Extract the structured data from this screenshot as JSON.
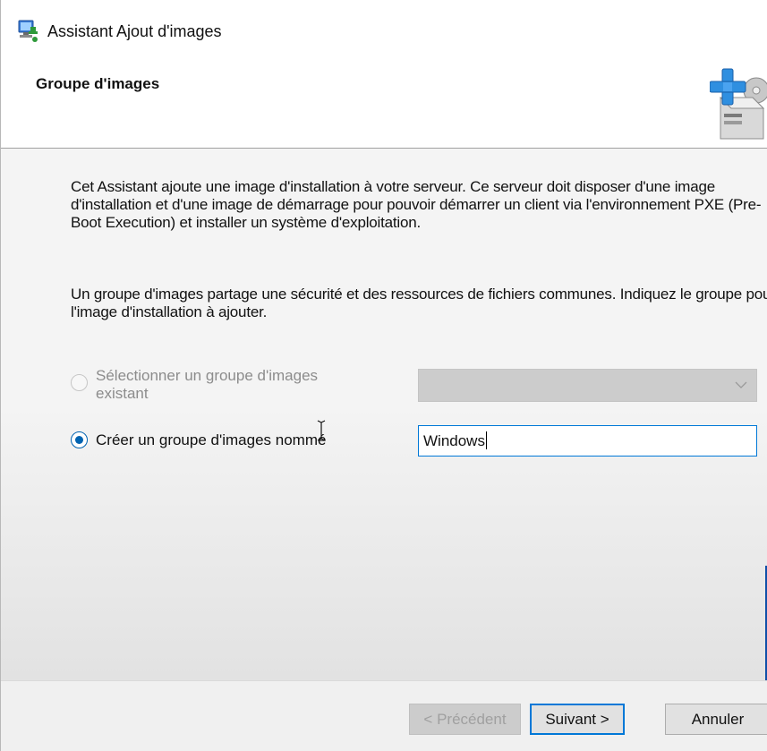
{
  "window": {
    "title": "Assistant Ajout d'images",
    "icon": "wds-server-icon"
  },
  "header": {
    "title": "Groupe d'images",
    "icon": "add-image-disk-icon"
  },
  "content": {
    "paragraph1": "Cet Assistant ajoute une image d'installation à votre serveur. Ce serveur doit disposer d'une image d'installation et d'une image de démarrage pour pouvoir démarrer un client via l'environnement PXE (Pre-Boot Execution) et installer un système d'exploitation.",
    "paragraph2": "Un groupe d'images partage une sécurité et des ressources de fichiers communes. Indiquez le groupe pour l'image d'installation à ajouter.",
    "option_existing": {
      "label": "Sélectionner un groupe d'images existant",
      "selected": false,
      "enabled": false,
      "combo_value": ""
    },
    "option_new": {
      "label": "Créer un groupe d'images nommé",
      "selected": true,
      "enabled": true,
      "input_value": "Windows"
    }
  },
  "footer": {
    "prev_label": "< Précédent",
    "next_label": "Suivant >",
    "cancel_label": "Annuler"
  },
  "colors": {
    "accent": "#0078d7",
    "radio": "#0063b1"
  }
}
